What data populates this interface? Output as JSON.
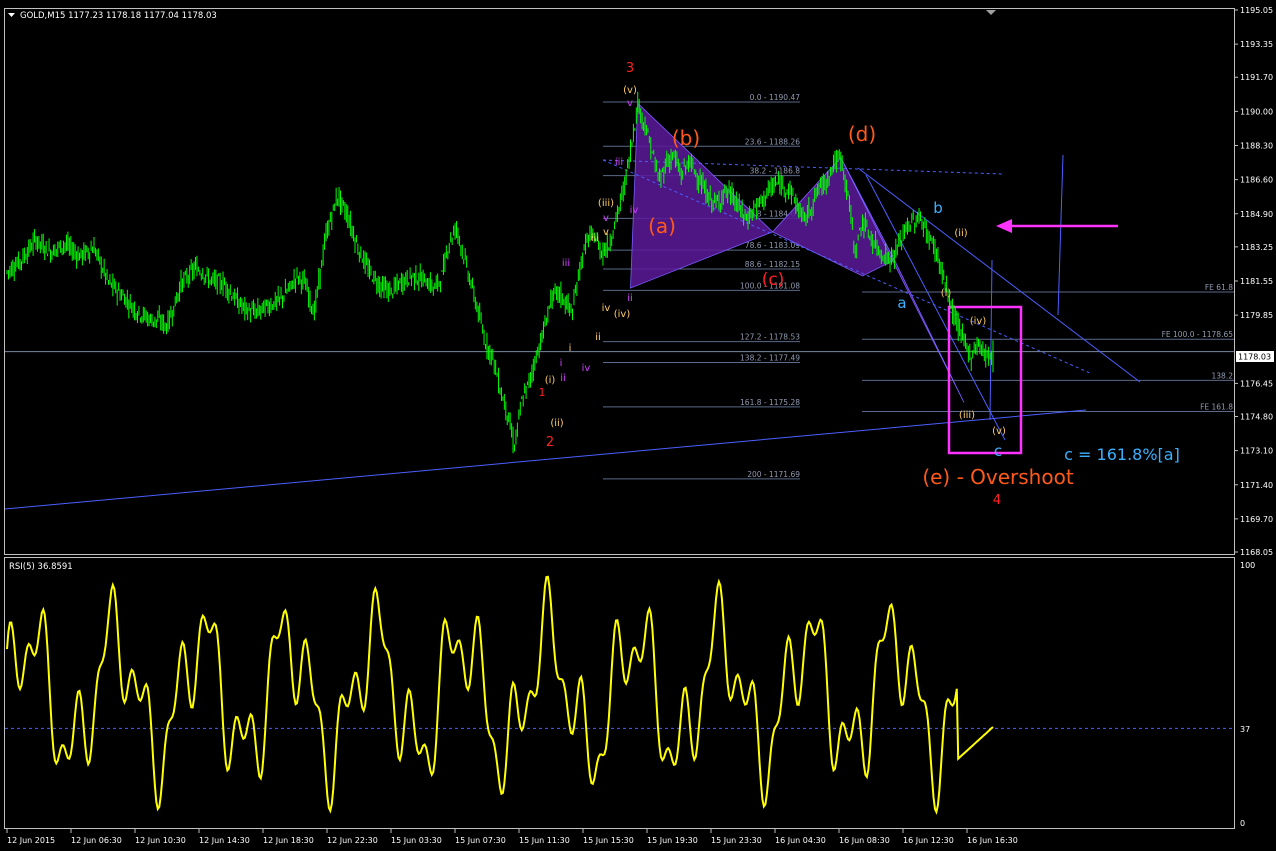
{
  "window": {
    "header": "GOLD,M15  1177.23 1178.18 1177.04 1178.03",
    "current_price_tag": "1178.03"
  },
  "rsi_panel": {
    "label": "RSI(5) 36.8591",
    "level_label": "37",
    "top_label": "100",
    "bottom_label": "0"
  },
  "colors": {
    "background": "#000000",
    "candles": "#00ff00",
    "rsi_line": "#ffff00",
    "trendlines": "#4a5fff",
    "fib_lines": "#5a6a8a",
    "triangle_fill": "#5a1a9a",
    "box": "#ff33ff",
    "wave_orange": "#ff5a1a",
    "wave_red": "#ff2020",
    "wave_blue": "#3ab0ff",
    "roman_purple": "#d040ff",
    "roman_yellow": "#ffcc66"
  },
  "chart_data": [
    {
      "type": "candlestick",
      "symbol": "GOLD",
      "timeframe": "M15",
      "ylim": [
        1168.05,
        1195.05
      ],
      "y_ticks": [
        "1195.05",
        "1193.35",
        "1191.70",
        "1190.00",
        "1188.30",
        "1186.60",
        "1184.90",
        "1183.25",
        "1181.55",
        "1179.85",
        "1178.03",
        "1176.45",
        "1174.80",
        "1173.10",
        "1171.40",
        "1169.70",
        "1168.05"
      ],
      "x_ticks": [
        "12 Jun 2015",
        "12 Jun 06:30",
        "12 Jun 10:30",
        "12 Jun 14:30",
        "12 Jun 18:30",
        "12 Jun 22:30",
        "15 Jun 03:30",
        "15 Jun 07:30",
        "15 Jun 11:30",
        "15 Jun 15:30",
        "15 Jun 19:30",
        "15 Jun 23:30",
        "16 Jun 04:30",
        "16 Jun 08:30",
        "16 Jun 12:30",
        "16 Jun 16:30"
      ],
      "price_path": [
        [
          0,
          1182.0
        ],
        [
          10,
          1182.6
        ],
        [
          20,
          1183.6
        ],
        [
          30,
          1183.0
        ],
        [
          40,
          1183.4
        ],
        [
          50,
          1182.8
        ],
        [
          60,
          1183.2
        ],
        [
          70,
          1181.5
        ],
        [
          80,
          1180.8
        ],
        [
          90,
          1180.0
        ],
        [
          100,
          1179.6
        ],
        [
          105,
          1179.6
        ],
        [
          110,
          1179.3
        ],
        [
          115,
          1180.2
        ],
        [
          120,
          1181.4
        ],
        [
          125,
          1181.8
        ],
        [
          130,
          1182.2
        ],
        [
          135,
          1182.0
        ],
        [
          140,
          1181.6
        ],
        [
          150,
          1181.4
        ],
        [
          158,
          1180.6
        ],
        [
          165,
          1180.1
        ],
        [
          172,
          1180.0
        ],
        [
          180,
          1180.3
        ],
        [
          188,
          1180.6
        ],
        [
          195,
          1181.2
        ],
        [
          200,
          1181.8
        ],
        [
          205,
          1181.5
        ],
        [
          212,
          1180.0
        ],
        [
          220,
          1183.8
        ],
        [
          228,
          1185.8
        ],
        [
          235,
          1184.8
        ],
        [
          242,
          1183.2
        ],
        [
          250,
          1182.0
        ],
        [
          258,
          1181.3
        ],
        [
          265,
          1181.0
        ],
        [
          272,
          1181.5
        ],
        [
          280,
          1181.8
        ],
        [
          288,
          1181.6
        ],
        [
          295,
          1181.2
        ],
        [
          300,
          1181.8
        ],
        [
          305,
          1183.5
        ],
        [
          310,
          1184.2
        ],
        [
          318,
          1182.0
        ],
        [
          325,
          1180.0
        ],
        [
          330,
          1178.5
        ],
        [
          335,
          1177.8
        ],
        [
          340,
          1176.2
        ],
        [
          345,
          1175.0
        ],
        [
          350,
          1173.3
        ],
        [
          355,
          1175.5
        ],
        [
          360,
          1176.5
        ],
        [
          365,
          1177.8
        ],
        [
          370,
          1179.0
        ],
        [
          375,
          1180.6
        ],
        [
          380,
          1181.0
        ],
        [
          385,
          1180.5
        ],
        [
          390,
          1180.0
        ],
        [
          395,
          1182.2
        ],
        [
          400,
          1183.6
        ],
        [
          405,
          1183.8
        ],
        [
          410,
          1183.0
        ],
        [
          415,
          1183.3
        ],
        [
          420,
          1184.6
        ],
        [
          425,
          1186.0
        ],
        [
          430,
          1188.0
        ],
        [
          435,
          1190.4
        ],
        [
          440,
          1189.3
        ],
        [
          445,
          1188.0
        ],
        [
          450,
          1186.5
        ],
        [
          455,
          1187.5
        ],
        [
          460,
          1187.8
        ],
        [
          465,
          1186.8
        ],
        [
          470,
          1187.5
        ],
        [
          475,
          1187.0
        ],
        [
          480,
          1186.2
        ],
        [
          485,
          1185.6
        ],
        [
          490,
          1185.4
        ],
        [
          495,
          1186.0
        ],
        [
          500,
          1185.8
        ],
        [
          505,
          1185.2
        ],
        [
          510,
          1184.6
        ],
        [
          515,
          1185.1
        ],
        [
          520,
          1185.5
        ],
        [
          525,
          1186.0
        ],
        [
          530,
          1186.4
        ],
        [
          535,
          1186.3
        ],
        [
          540,
          1186.1
        ],
        [
          545,
          1185.3
        ],
        [
          550,
          1184.6
        ],
        [
          555,
          1185.3
        ],
        [
          560,
          1186.2
        ],
        [
          565,
          1186.5
        ],
        [
          570,
          1187.4
        ],
        [
          575,
          1187.7
        ],
        [
          580,
          1185.9
        ],
        [
          585,
          1183.0
        ],
        [
          590,
          1184.5
        ],
        [
          595,
          1183.8
        ],
        [
          600,
          1183.2
        ],
        [
          605,
          1182.8
        ],
        [
          610,
          1182.6
        ],
        [
          615,
          1183.3
        ],
        [
          620,
          1184.2
        ],
        [
          625,
          1184.5
        ],
        [
          630,
          1184.7
        ],
        [
          635,
          1183.8
        ],
        [
          640,
          1183.2
        ],
        [
          645,
          1182.0
        ],
        [
          650,
          1180.5
        ],
        [
          655,
          1179.5
        ],
        [
          660,
          1178.5
        ],
        [
          665,
          1177.8
        ],
        [
          670,
          1178.5
        ],
        [
          675,
          1177.8
        ],
        [
          680,
          1178.0
        ]
      ],
      "price_label_note": "Price path approximated from the candlestick chart; x = bar index (15-minute bars), y = price."
    },
    {
      "type": "line",
      "name": "RSI(5)",
      "ylim": [
        0,
        100
      ],
      "level": 37,
      "last_value": 36.8591,
      "values_note": "RSI oscillator approximated by the page script."
    }
  ],
  "fib_retracement": {
    "levels": [
      {
        "label": "0.0 - 1190.47",
        "price": 1190.47
      },
      {
        "label": "23.6 - 1188.26",
        "price": 1188.26
      },
      {
        "label": "38.2 - 1186.8",
        "price": 1186.8
      },
      {
        "label": "61.8 - 1184.67",
        "price": 1184.67
      },
      {
        "label": "78.6 - 1183.09",
        "price": 1183.09
      },
      {
        "label": "88.6 - 1182.15",
        "price": 1182.15
      },
      {
        "label": "100.0 - 1181.08",
        "price": 1181.08
      },
      {
        "label": "127.2 - 1178.53",
        "price": 1178.53
      },
      {
        "label": "138.2 - 1177.49",
        "price": 1177.49
      },
      {
        "label": "161.8 - 1175.28",
        "price": 1175.28
      },
      {
        "label": "200 - 1171.69",
        "price": 1171.69
      }
    ]
  },
  "fib_expansion": {
    "levels": [
      {
        "label": "FE 61.8",
        "price": 1181.0
      },
      {
        "label": "FE 100.0 - 1178.65",
        "price": 1178.65
      },
      {
        "label": "138.2",
        "price": 1176.6
      },
      {
        "label": "FE 161.8",
        "price": 1175.05
      }
    ]
  },
  "wave_labels": {
    "three": "3",
    "two": "2",
    "one": "1",
    "four": "4",
    "a_big": "(a)",
    "b_big": "(b)",
    "c_big": "(c)",
    "d_big": "(d)",
    "e_label": "(e) - Overshoot",
    "a_small": "a",
    "b_small": "b",
    "c_small": "c",
    "c_ext": "c = 161.8%[a]",
    "v_paren": "(v)",
    "iv_paren": "(iv)",
    "iii_paren": "(iii)",
    "ii_paren": "(ii)",
    "i_paren": "(i)",
    "roman_v": "v",
    "roman_iv": "iv",
    "roman_iii": "iii",
    "roman_ii": "ii",
    "roman_i": "i"
  }
}
